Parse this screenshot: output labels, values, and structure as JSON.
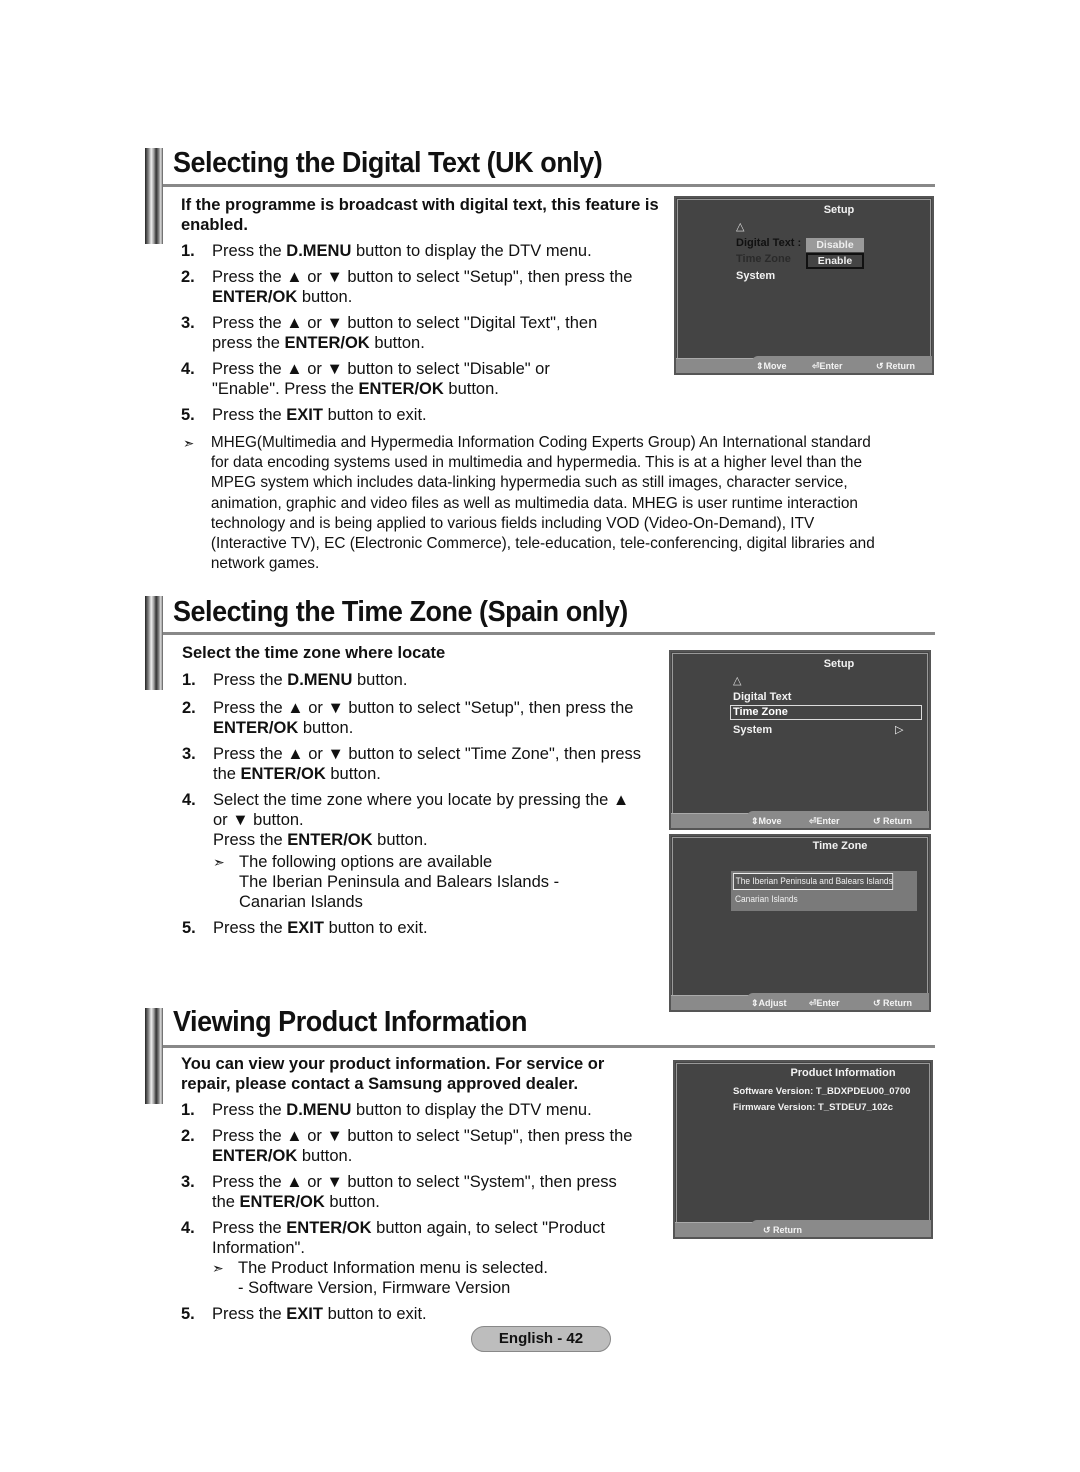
{
  "sections": {
    "digital_text": {
      "title": "Selecting the Digital Text (UK only)",
      "intro": "If the programme is broadcast with digital text, this feature is enabled.",
      "steps": [
        {
          "num": "1.",
          "pre": "Press the ",
          "bold": "D.MENU",
          "post": " button to display the DTV menu."
        },
        {
          "num": "2.",
          "pre": "Press the ▲ or ▼ button to select \"Setup\", then press the ",
          "bold": "ENTER/OK",
          "post": " button."
        },
        {
          "num": "3.",
          "pre": "Press the ▲ or ▼ button to select \"Digital Text\", then press the ",
          "bold": "ENTER/OK",
          "post": " button."
        },
        {
          "num": "4.",
          "pre": "Press the ▲ or ▼ button to select \"Disable\" or \"Enable\". Press the ",
          "bold": "ENTER/OK",
          "post": " button."
        },
        {
          "num": "5.",
          "pre": "Press the ",
          "bold": "EXIT",
          "post": " button to exit."
        }
      ],
      "note_arrow": "➣",
      "note": "MHEG(Multimedia and Hypermedia Information Coding Experts Group) An International standard for data encoding systems used in multimedia and hypermedia. This is at a higher level than the MPEG system which includes data-linking hypermedia such as still images, character service, animation, graphic and video files as well as multimedia data. MHEG is user runtime interaction technology and is being applied to various fields including VOD (Video-On-Demand), ITV (Interactive TV), EC (Electronic Commerce), tele-education, tele-conferencing, digital libraries and network games.",
      "screen": {
        "title": "Setup",
        "up_icon": "△",
        "items": [
          "Digital Text :",
          "Time Zone",
          "System"
        ],
        "options": [
          "Disable",
          "Enable"
        ],
        "footer": {
          "move": "⇕Move",
          "enter": "⏎Enter",
          "return": "↺ Return"
        }
      }
    },
    "time_zone": {
      "title": "Selecting the Time Zone (Spain only)",
      "intro": "Select the time zone where locate",
      "steps": [
        {
          "num": "1.",
          "pre": "Press the ",
          "bold": "D.MENU",
          "post": " button."
        },
        {
          "num": "2.",
          "pre": "Press the ▲ or ▼ button to select \"Setup\", then press the ",
          "bold": "ENTER/OK",
          "post": " button."
        },
        {
          "num": "3.",
          "pre": "Press the ▲ or ▼ button to select \"Time Zone\", then press the ",
          "bold": "ENTER/OK",
          "post": " button."
        },
        {
          "num": "4.",
          "pre": "Select the time zone where you locate by pressing the ▲ or ▼ button.",
          "bold": "",
          "post": ""
        },
        {
          "num": "5.",
          "pre": "Press the ",
          "bold": "EXIT",
          "post": " button to exit."
        }
      ],
      "step4_extra": {
        "pre": "Press the ",
        "bold": "ENTER/OK",
        "post": " button."
      },
      "note_arrow": "➣",
      "note_lines": [
        "The following options are available",
        "The Iberian Peninsula and Balears Islands -",
        "Canarian Islands"
      ],
      "screen_setup": {
        "title": "Setup",
        "up_icon": "△",
        "items": [
          "Digital Text",
          "Time Zone",
          "System"
        ],
        "system_arrow": "▷",
        "footer": {
          "move": "⇕Move",
          "enter": "⏎Enter",
          "return": "↺ Return"
        }
      },
      "screen_tz": {
        "title": "Time Zone",
        "options": [
          "The Iberian Peninsula and Balears Islands",
          "Canarian Islands"
        ],
        "footer": {
          "adjust": "⇕Adjust",
          "enter": "⏎Enter",
          "return": "↺ Return"
        }
      }
    },
    "product_info": {
      "title": "Viewing Product Information",
      "intro": "You can view your product information. For service or repair, please contact a Samsung approved dealer.",
      "steps": [
        {
          "num": "1.",
          "pre": "Press the ",
          "bold": "D.MENU",
          "post": " button to display the DTV menu."
        },
        {
          "num": "2.",
          "pre": "Press the ▲ or ▼ button to select \"Setup\", then press the ",
          "bold": "ENTER/OK",
          "post": " button."
        },
        {
          "num": "3.",
          "pre": "Press the ▲ or ▼ button to select \"System\", then press the ",
          "bold": "ENTER/OK",
          "post": " button."
        },
        {
          "num": "4.",
          "pre": "Press the ",
          "bold": "ENTER/OK",
          "post": " button again, to select \"Product Information\"."
        },
        {
          "num": "5.",
          "pre": "Press the ",
          "bold": "EXIT",
          "post": " button to exit."
        }
      ],
      "note_arrow": "➣",
      "note_lines": [
        "The Product Information menu is selected.",
        "- Software Version, Firmware Version"
      ],
      "screen": {
        "title": "Product Information",
        "software": "Software Version: T_BDXPDEU00_0700",
        "firmware": "Firmware Version: T_STDEU7_102c",
        "footer": {
          "return": "↺ Return"
        }
      }
    }
  },
  "footer": {
    "page_label": "English - 42"
  }
}
